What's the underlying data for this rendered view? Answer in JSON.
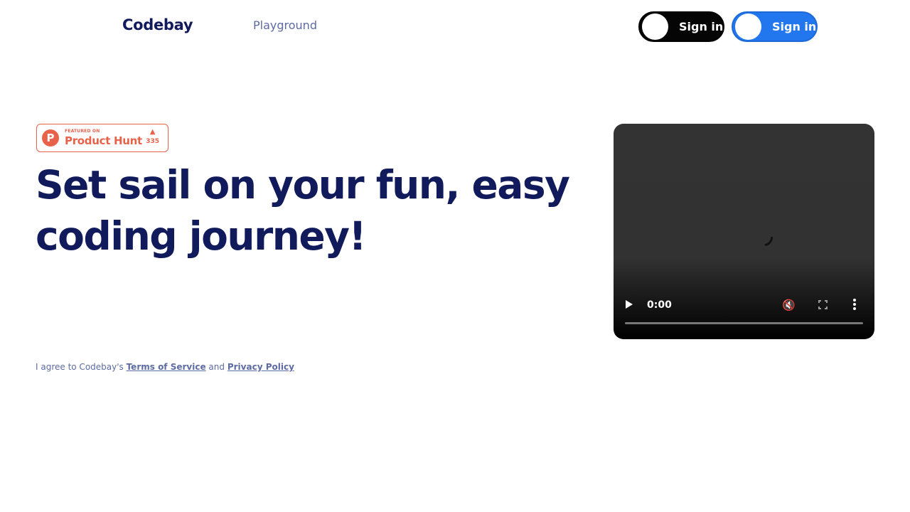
{
  "header": {
    "logo": "Codebay",
    "nav": {
      "playground": "Playground"
    },
    "signin_dark": "Sign in",
    "signin_blue": "Sign in"
  },
  "badge": {
    "featured": "FEATURED ON",
    "name": "Product Hunt",
    "logo_letter": "P",
    "arrow": "▲",
    "votes": "335"
  },
  "hero": {
    "line1": "Set sail on your fun, easy",
    "line2": "coding journey!"
  },
  "terms": {
    "prefix": "I agree to Codebay's ",
    "tos": "Terms of Service",
    "and": " and ",
    "privacy": "Privacy Policy"
  },
  "video": {
    "time": "0:00",
    "progress": 0,
    "icons": [
      "play-icon",
      "mute-icon",
      "fullscreen-icon",
      "more-options-icon",
      "loading-spinner"
    ]
  },
  "colors": {
    "brand_navy": "#111b5c",
    "muted_link": "#5c6ba3",
    "accent_blue": "#2277ee",
    "product_hunt": "#e8624a"
  }
}
